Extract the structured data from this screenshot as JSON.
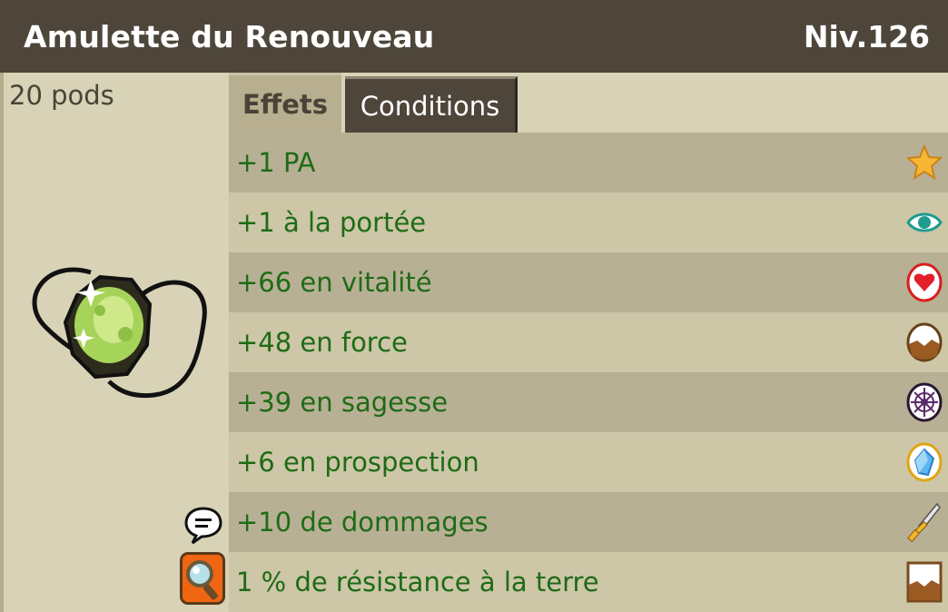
{
  "item": {
    "name": "Amulette du Renouveau",
    "level": "Niv.126",
    "weight": "20 pods"
  },
  "tabs": [
    {
      "label": "Effets",
      "active": true
    },
    {
      "label": "Conditions",
      "active": false
    }
  ],
  "effects": [
    {
      "text": "+1 PA",
      "icon": "star-icon"
    },
    {
      "text": "+1 à la portée",
      "icon": "eye-icon"
    },
    {
      "text": "+66 en vitalité",
      "icon": "heart-icon"
    },
    {
      "text": "+48 en force",
      "icon": "earth-strength-icon"
    },
    {
      "text": "+39 en sagesse",
      "icon": "wisdom-icon"
    },
    {
      "text": "+6 en prospection",
      "icon": "prospection-gem-icon"
    },
    {
      "text": "+10 de dommages",
      "icon": "sword-icon"
    },
    {
      "text": "1 % de résistance à la terre",
      "icon": "earth-resistance-icon"
    }
  ],
  "colors": {
    "header_bg": "#4e463a",
    "effect_text": "#1e6b16",
    "row_dark": "#b8b094",
    "row_light": "#cdc6a7"
  }
}
